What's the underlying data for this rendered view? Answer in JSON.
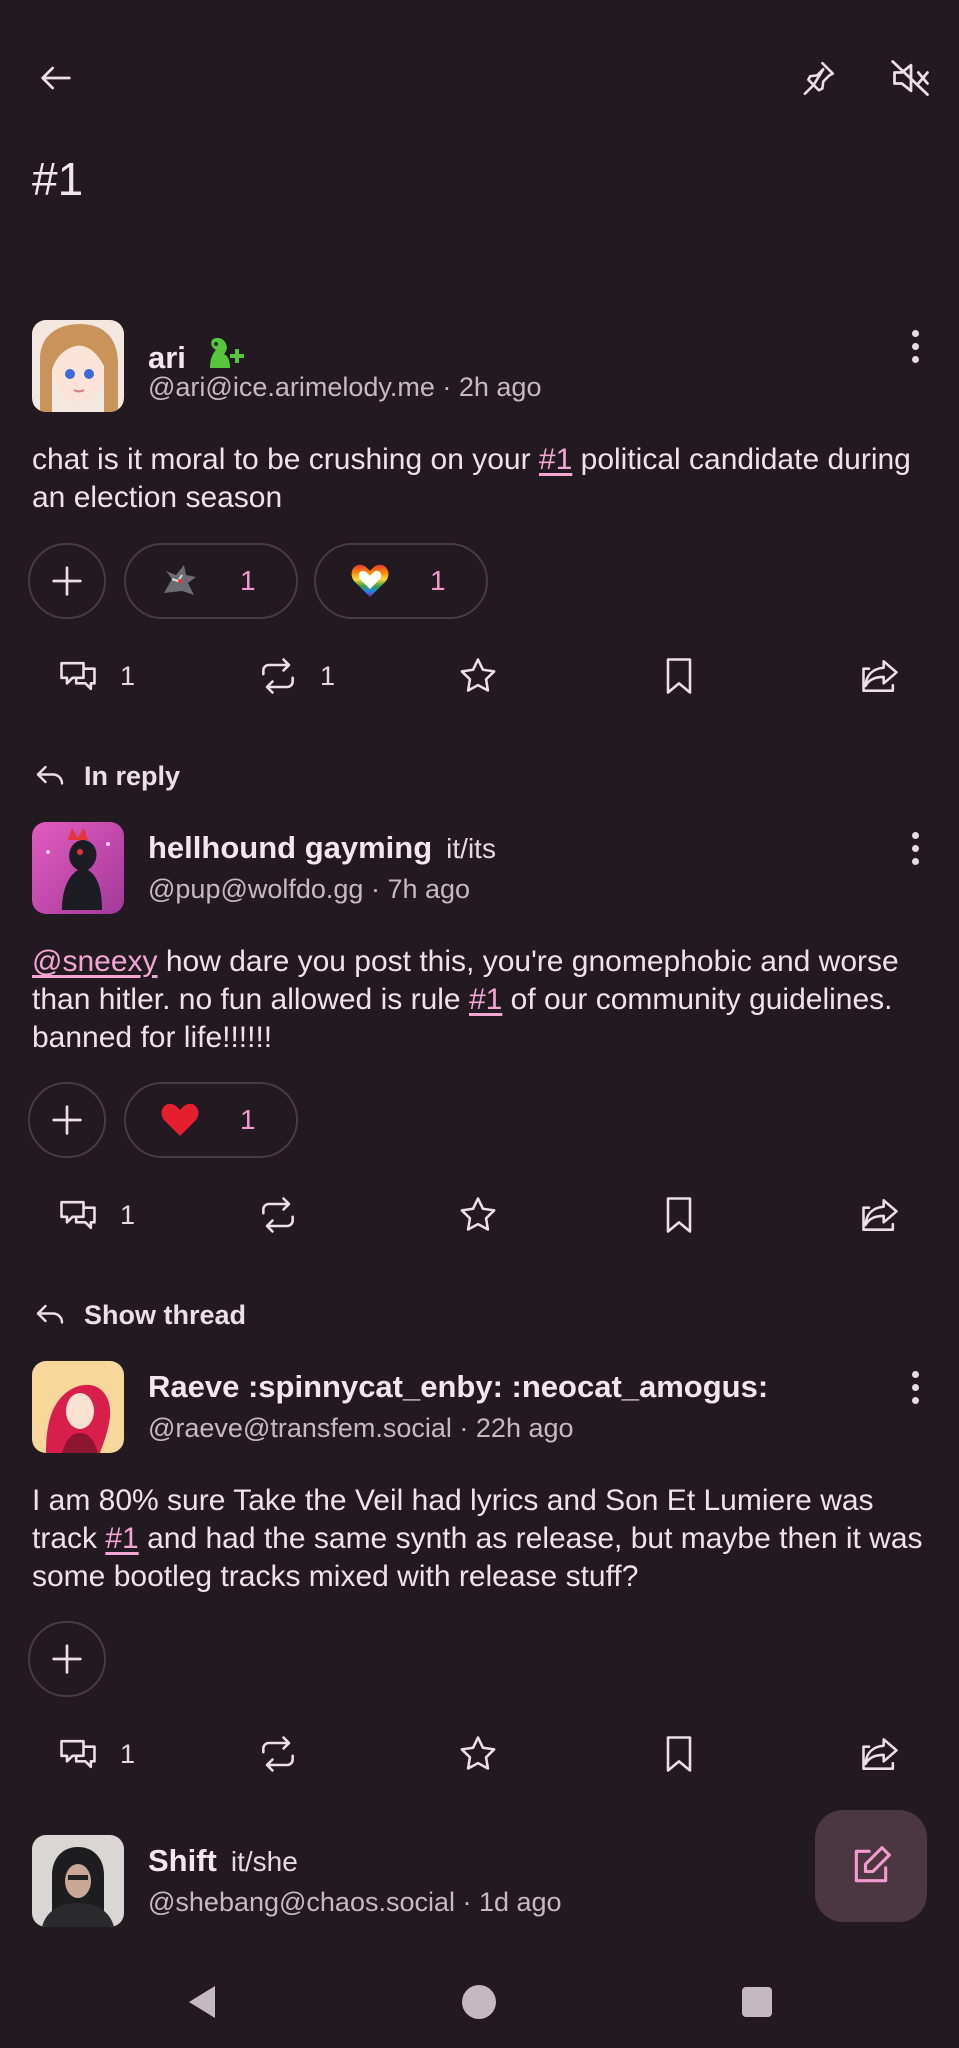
{
  "header": {
    "title": "#1",
    "back_icon": "arrow-left-icon",
    "pin_icon": "pin-icon",
    "mute_icon": "speaker-muted-icon"
  },
  "posts": [
    {
      "name": "ari",
      "name_emoji": "green-dino-plus-emoji",
      "handle": "@ari@ice.arimelody.me · 2h ago",
      "text_before": "chat is it moral to be crushing on your ",
      "tag": "#1",
      "text_after": " political candidate during an election season",
      "reactions": [
        {
          "emoji": "dragon-emoji",
          "count": "1"
        },
        {
          "emoji": "rainbow-heart-emoji",
          "count": "1"
        }
      ],
      "replies": "1",
      "boosts": "1"
    },
    {
      "context_label": "In reply",
      "name": "hellhound gayming",
      "pronouns": "it/its",
      "handle": "@pup@wolfdo.gg · 7h ago",
      "mention": "@sneexy",
      "text_a": " how dare you post this, you're gnomephobic and worse than hitler. no fun allowed is rule ",
      "tag": "#1",
      "text_b": " of our community guidelines. banned for life!!!!!!",
      "reactions": [
        {
          "emoji": "red-heart-emoji",
          "count": "1"
        }
      ],
      "replies": "1"
    },
    {
      "context_label": "Show thread",
      "name": "Raeve :spinnycat_enby: :neocat_amogus:",
      "handle": "@raeve@transfem.social · 22h ago",
      "text_a": "I am 80% sure Take the Veil had lyrics and Son Et Lumiere was track ",
      "tag": "#1",
      "text_b": " and had the same synth as release, but maybe then it was some bootleg tracks mixed with release stuff?",
      "replies": "1"
    },
    {
      "name": "Shift",
      "pronouns": "it/she",
      "handle": "@shebang@chaos.social · 1d ago"
    }
  ],
  "fab": {
    "icon": "compose-icon"
  },
  "colors": {
    "background": "#231920",
    "accent": "#f3a6d4",
    "fab": "#4b3642"
  }
}
